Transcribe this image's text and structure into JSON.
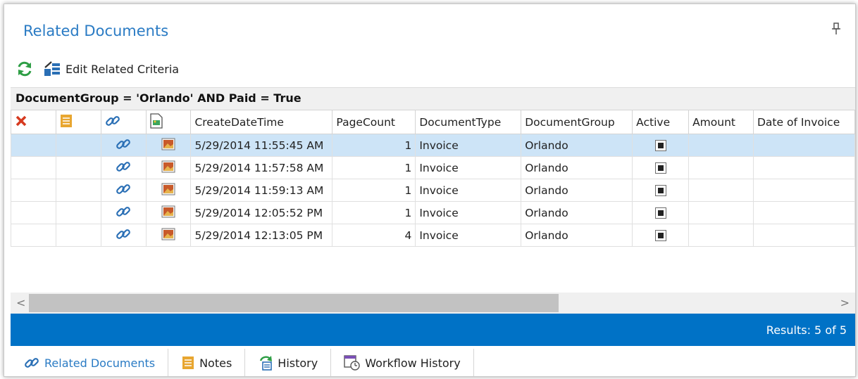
{
  "panel": {
    "title": "Related Documents"
  },
  "toolbar": {
    "refresh_icon": "refresh-icon",
    "edit_label": "Edit Related Criteria"
  },
  "criteria": "DocumentGroup = 'Orlando' AND Paid = True",
  "grid": {
    "columns": [
      "CreateDateTime",
      "PageCount",
      "DocumentType",
      "DocumentGroup",
      "Active",
      "Amount",
      "Date of Invoice"
    ],
    "rows": [
      {
        "created": "5/29/2014 11:55:45 AM",
        "pages": "1",
        "type": "Invoice",
        "group": "Orlando",
        "active": true,
        "selected": true
      },
      {
        "created": "5/29/2014 11:57:58 AM",
        "pages": "1",
        "type": "Invoice",
        "group": "Orlando",
        "active": true
      },
      {
        "created": "5/29/2014 11:59:13 AM",
        "pages": "1",
        "type": "Invoice",
        "group": "Orlando",
        "active": true
      },
      {
        "created": "5/29/2014 12:05:52 PM",
        "pages": "1",
        "type": "Invoice",
        "group": "Orlando",
        "active": true
      },
      {
        "created": "5/29/2014 12:13:05 PM",
        "pages": "4",
        "type": "Invoice",
        "group": "Orlando",
        "active": true
      }
    ]
  },
  "status": {
    "results": "Results: 5 of 5"
  },
  "tabs": [
    {
      "label": "Related Documents",
      "icon": "link-icon",
      "active": true
    },
    {
      "label": "Notes",
      "icon": "notes-icon"
    },
    {
      "label": "History",
      "icon": "history-icon"
    },
    {
      "label": "Workflow History",
      "icon": "workflow-history-icon"
    }
  ],
  "colors": {
    "accent": "#0072c6",
    "title": "#2a7bc4",
    "selected_row": "#cde4f7"
  }
}
